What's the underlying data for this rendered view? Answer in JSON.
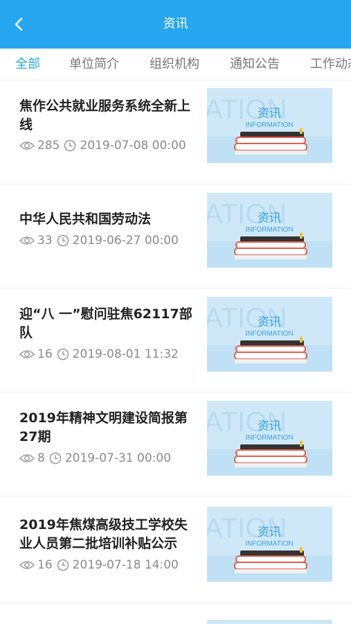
{
  "header": {
    "title": "资讯",
    "back_icon": "chevron-left-icon"
  },
  "tabs": [
    {
      "label": "全部",
      "active": true
    },
    {
      "label": "单位简介",
      "active": false
    },
    {
      "label": "组织机构",
      "active": false
    },
    {
      "label": "通知公告",
      "active": false
    },
    {
      "label": "工作动态",
      "active": false
    }
  ],
  "thumb": {
    "title": "资讯",
    "subtitle": "INFORMATION",
    "watermark": "ATION"
  },
  "colors": {
    "accent": "#26a6ef",
    "text": "#222222",
    "meta": "#8a8a8a"
  },
  "items": [
    {
      "title": "焦作公共就业服务系统全新上线",
      "views": "285",
      "date": "2019-07-08 00:00"
    },
    {
      "title": "中华人民共和国劳动法",
      "views": "33",
      "date": "2019-06-27 00:00"
    },
    {
      "title": "迎“八 一”慰问驻焦62117部队",
      "views": "16",
      "date": "2019-08-01 11:32"
    },
    {
      "title": "2019年精神文明建设简报第27期",
      "views": "8",
      "date": "2019-07-31 00:00"
    },
    {
      "title": "2019年焦煤高级技工学校失业人员第二批培训补贴公示",
      "views": "16",
      "date": "2019-07-18 14:00"
    }
  ]
}
